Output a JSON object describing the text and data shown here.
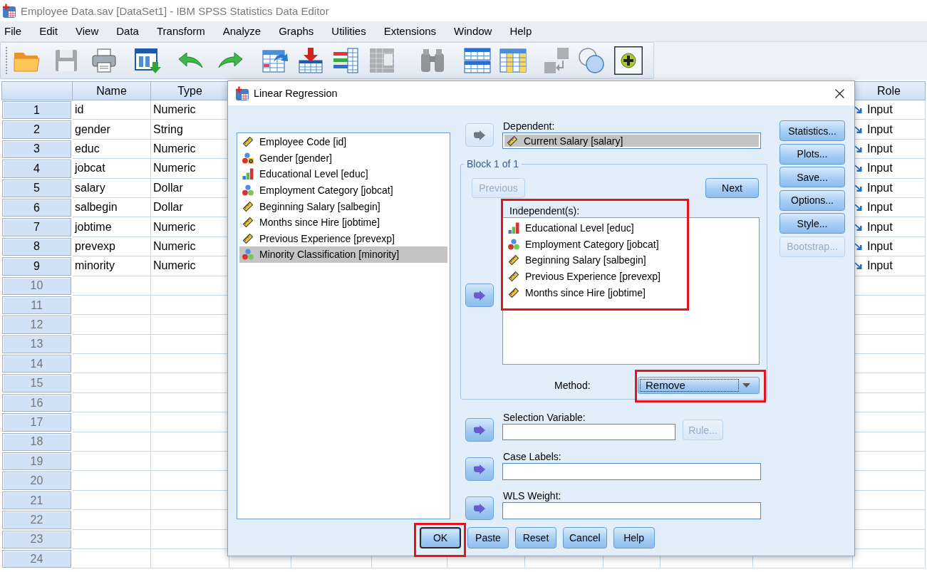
{
  "window": {
    "title": "Employee Data.sav [DataSet1] - IBM SPSS Statistics Data Editor"
  },
  "menu": [
    "File",
    "Edit",
    "View",
    "Data",
    "Transform",
    "Analyze",
    "Graphs",
    "Utilities",
    "Extensions",
    "Window",
    "Help"
  ],
  "toolbar": [
    {
      "disabled": false,
      "pressed": false
    },
    {
      "disabled": true,
      "pressed": false
    },
    {
      "disabled": false,
      "pressed": false
    },
    {
      "disabled": false,
      "pressed": false
    },
    {
      "disabled": false,
      "pressed": false
    },
    {
      "disabled": false,
      "pressed": false
    },
    {
      "disabled": false,
      "pressed": false
    },
    {
      "disabled": false,
      "pressed": false
    },
    {
      "disabled": false,
      "pressed": false
    },
    {
      "disabled": true,
      "pressed": false
    },
    {
      "disabled": true,
      "pressed": false
    },
    {
      "disabled": false,
      "pressed": false
    },
    {
      "disabled": false,
      "pressed": false
    },
    {
      "disabled": true,
      "pressed": false
    },
    {
      "disabled": false,
      "pressed": false
    },
    {
      "disabled": false,
      "pressed": true
    }
  ],
  "grid": {
    "columns": [
      {
        "heading": "Name"
      },
      {
        "heading": "Type"
      },
      {
        "heading": "Role"
      }
    ],
    "rows": [
      {
        "number": "1",
        "name": "id",
        "type": "Numeric",
        "role": "Input"
      },
      {
        "number": "2",
        "name": "gender",
        "type": "String",
        "role": "Input"
      },
      {
        "number": "3",
        "name": "educ",
        "type": "Numeric",
        "role": "Input"
      },
      {
        "number": "4",
        "name": "jobcat",
        "type": "Numeric",
        "role": "Input"
      },
      {
        "number": "5",
        "name": "salary",
        "type": "Dollar",
        "role": "Input"
      },
      {
        "number": "6",
        "name": "salbegin",
        "type": "Dollar",
        "role": "Input"
      },
      {
        "number": "7",
        "name": "jobtime",
        "type": "Numeric",
        "role": "Input"
      },
      {
        "number": "8",
        "name": "prevexp",
        "type": "Numeric",
        "role": "Input"
      },
      {
        "number": "9",
        "name": "minority",
        "type": "Numeric",
        "role": "Input"
      },
      {
        "number": "10"
      },
      {
        "number": "11"
      },
      {
        "number": "12"
      },
      {
        "number": "13"
      },
      {
        "number": "14"
      },
      {
        "number": "15"
      },
      {
        "number": "16"
      },
      {
        "number": "17"
      },
      {
        "number": "18"
      },
      {
        "number": "19"
      },
      {
        "number": "20"
      },
      {
        "number": "21"
      },
      {
        "number": "22"
      },
      {
        "number": "23"
      },
      {
        "number": "24"
      }
    ]
  },
  "dialog": {
    "title": "Linear Regression",
    "variables": [
      {
        "label": "Employee Code [id]",
        "kind": "scale",
        "selected": false
      },
      {
        "label": "Gender [gender]",
        "kind": "string",
        "selected": false
      },
      {
        "label": "Educational Level [educ]",
        "kind": "ordinal",
        "selected": false
      },
      {
        "label": "Employment Category [jobcat]",
        "kind": "nominal",
        "selected": false
      },
      {
        "label": "Beginning Salary [salbegin]",
        "kind": "scale",
        "selected": false
      },
      {
        "label": "Months since Hire [jobtime]",
        "kind": "scale",
        "selected": false
      },
      {
        "label": "Previous Experience [prevexp]",
        "kind": "scale",
        "selected": false
      },
      {
        "label": "Minority Classification [minority]",
        "kind": "nominal",
        "selected": true
      }
    ],
    "dependent": {
      "label": "Dependent:",
      "arrow_disabled": true,
      "item": {
        "label": "Current Salary [salary]",
        "kind": "scale",
        "selected": true
      }
    },
    "block": {
      "legend": "Block 1 of 1",
      "previous": {
        "label": "Previous",
        "disabled": true
      },
      "next": {
        "label": "Next",
        "disabled": false
      },
      "independents": {
        "label": "Independent(s):",
        "arrow_disabled": false,
        "highlighted": true,
        "items": [
          {
            "label": "Educational Level [educ]",
            "kind": "ordinal",
            "selected": false
          },
          {
            "label": "Employment Category [jobcat]",
            "kind": "nominal",
            "selected": false
          },
          {
            "label": "Beginning Salary [salbegin]",
            "kind": "scale",
            "selected": false
          },
          {
            "label": "Previous Experience [prevexp]",
            "kind": "scale",
            "selected": false
          },
          {
            "label": "Months since Hire [jobtime]",
            "kind": "scale",
            "selected": false
          }
        ]
      },
      "method": {
        "label": "Method:",
        "value": "Remove",
        "focused": true,
        "highlighted": true
      }
    },
    "side_buttons": [
      {
        "label": "Statistics...",
        "disabled": false
      },
      {
        "label": "Plots...",
        "disabled": false
      },
      {
        "label": "Save...",
        "disabled": false
      },
      {
        "label": "Options...",
        "disabled": false
      },
      {
        "label": "Style...",
        "disabled": false
      },
      {
        "label": "Bootstrap...",
        "disabled": true
      }
    ],
    "selection_variable": {
      "label": "Selection Variable:",
      "arrow_disabled": false,
      "rule_button": {
        "label": "Rule...",
        "disabled": true
      }
    },
    "case_labels": {
      "label": "Case Labels:",
      "arrow_disabled": false
    },
    "wls_weight": {
      "label": "WLS Weight:",
      "arrow_disabled": false
    },
    "buttons": [
      {
        "label": "OK",
        "focused": true,
        "highlighted": true
      },
      {
        "label": "Paste",
        "focused": false,
        "highlighted": false
      },
      {
        "label": "Reset",
        "focused": false,
        "highlighted": false
      },
      {
        "label": "Cancel",
        "focused": false,
        "highlighted": false
      },
      {
        "label": "Help",
        "focused": false,
        "highlighted": false
      }
    ]
  }
}
